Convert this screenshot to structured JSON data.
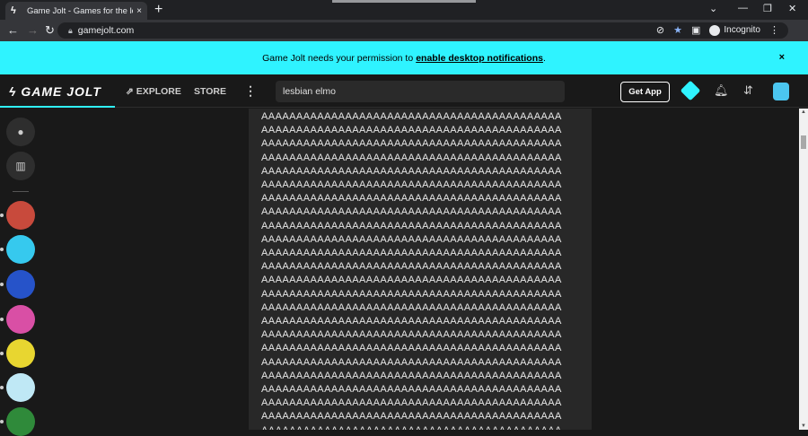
{
  "browser": {
    "tab_title": "Game Jolt - Games for the love o",
    "url": "gamejolt.com",
    "incognito_label": "Incognito"
  },
  "banner": {
    "text_before": "Game Jolt needs your permission to",
    "link": "enable desktop notifications",
    "text_after": ".",
    "close": "×"
  },
  "header": {
    "logo": "GAME JOLT",
    "explore": "EXPLORE",
    "store": "STORE",
    "search_value": "lesbian elmo",
    "get_app": "Get App"
  },
  "post": {
    "lines": [
      "AAAAAAAAAAAAAAAAAAAAAAAAAAAAAAAAAAAAAAAAAAA",
      "AAAAAAAAAAAAAAAAAAAAAAAAAAAAAAAAAAAAAAAAAAA",
      "AAAAAAAAAAAAAAAAAAAAAAAAAAAAAAAAAAAAAAAAAAA",
      "AAAAAAAAAAAAAAAAAAAAAAAAAAAAAAAAAAAAAAAAAAA",
      "AAAAAAAAAAAAAAAAAAAAAAAAAAAAAAAAAAAAAAAAAAA",
      "AAAAAAAAAAAAAAAAAAAAAAAAAAAAAAAAAAAAAAAAAAA",
      "AAAAAAAAAAAAAAAAAAAAAAAAAAAAAAAAAAAAAAAAAAA",
      "AAAAAAAAAAAAAAAAAAAAAAAAAAAAAAAAAAAAAAAAAAA",
      "AAAAAAAAAAAAAAAAAAAAAAAAAAAAAAAAAAAAAAAAAAA",
      "AAAAAAAAAAAAAAAAAAAAAAAAAAAAAAAAAAAAAAAAAAA",
      "AAAAAAAAAAAAAAAAAAAAAAAAAAAAAAAAAAAAAAAAAAA",
      "AAAAAAAAAAAAAAAAAAAAAAAAAAAAAAAAAAAAAAAAAAA",
      "AAAAAAAAAAAAAAAAAAAAAAAAAAAAAAAAAAAAAAAAAAA",
      "AAAAAAAAAAAAAAAAAAAAAAAAAAAAAAAAAAAAAAAAAAA",
      "AAAAAAAAAAAAAAAAAAAAAAAAAAAAAAAAAAAAAAAAAAA",
      "AAAAAAAAAAAAAAAAAAAAAAAAAAAAAAAAAAAAAAAAAAA",
      "AAAAAAAAAAAAAAAAAAAAAAAAAAAAAAAAAAAAAAAAAAA",
      "AAAAAAAAAAAAAAAAAAAAAAAAAAAAAAAAAAAAAAAAAAA",
      "AAAAAAAAAAAAAAAAAAAAAAAAAAAAAAAAAAAAAAAAAAA",
      "AAAAAAAAAAAAAAAAAAAAAAAAAAAAAAAAAAAAAAAAAAA",
      "AAAAAAAAAAAAAAAAAAAAAAAAAAAAAAAAAAAAAAAAAAA",
      "AAAAAAAAAAAAAAAAAAAAAAAAAAAAAAAAAAAAAAAAAAA",
      "AAAAAAAAAAAAAAAAAAAAAAAAAAAAAAAAAAAAAAAAAAA",
      "AAAAAAAAAAAAAAAAAAAAAAAAAAAAAAAAAAAAAAAAAAA"
    ]
  },
  "sidebar": {
    "avatar_colors": [
      "#c84a3c",
      "#36c9ee",
      "#2653c9",
      "#d94fa5",
      "#e8d630",
      "#bfe8f5",
      "#2f8a3a"
    ]
  },
  "colors": {
    "accent": "#2ff3ff",
    "background": "#191919",
    "post_bg": "#282828"
  }
}
